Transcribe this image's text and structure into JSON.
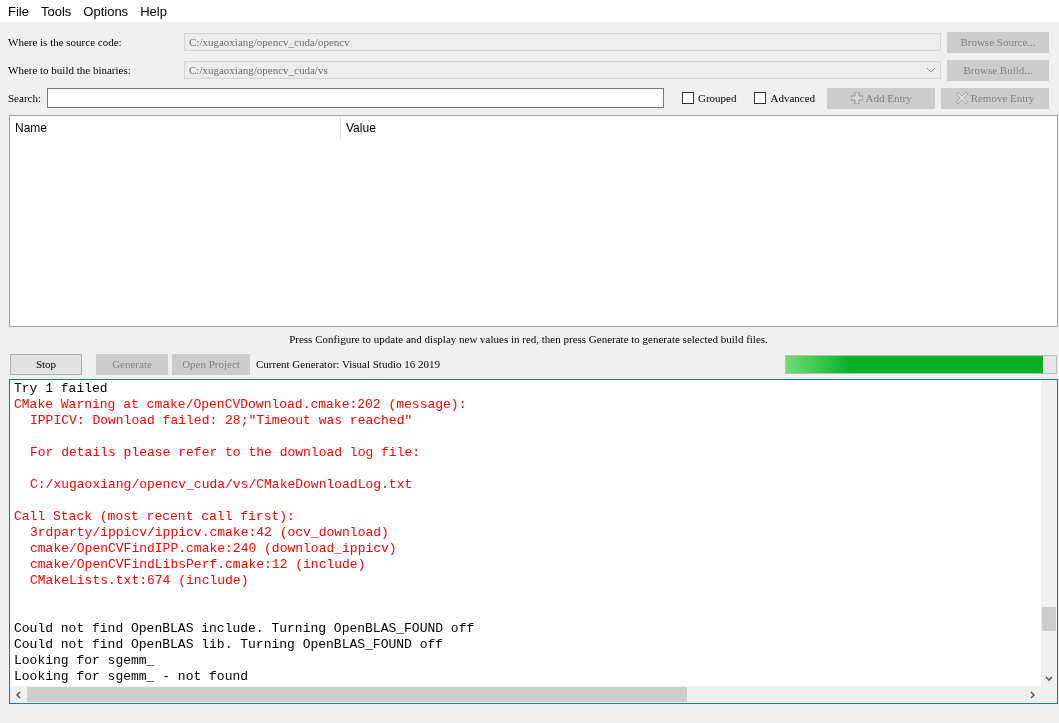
{
  "menu": [
    "File",
    "Tools",
    "Options",
    "Help"
  ],
  "source": {
    "label": "Where is the source code:",
    "value": "C:/xugaoxiang/opencv_cuda/opencv",
    "button": {
      "label": "Browse Source...",
      "disabled": true
    }
  },
  "build": {
    "label": "Where to build the binaries:",
    "value": "C:/xugaoxiang/opencv_cuda/vs",
    "button": {
      "label": "Browse Build...",
      "disabled": true
    }
  },
  "search": {
    "label": "Search:"
  },
  "options": [
    {
      "label": "Grouped",
      "checked": false
    },
    {
      "label": "Advanced",
      "checked": false
    }
  ],
  "entry_buttons": [
    {
      "kind": "add",
      "label": "Add Entry",
      "disabled": true
    },
    {
      "kind": "remove",
      "label": "Remove Entry",
      "disabled": true
    }
  ],
  "table": {
    "columns": [
      "Name",
      "Value"
    ]
  },
  "hint": "Press Configure to update and display new values in red, then press Generate to generate selected build files.",
  "actions": [
    {
      "label": "Stop",
      "disabled": false
    },
    {
      "label": "Generate",
      "disabled": true
    },
    {
      "label": "Open Project",
      "disabled": true
    }
  ],
  "generator": "Current Generator: Visual Studio 16 2019",
  "progress": {
    "level": 0.95
  },
  "log": [
    {
      "kind": "normal",
      "text": "Try 1 failed"
    },
    {
      "kind": "warning",
      "text": "CMake Warning at cmake/OpenCVDownload.cmake:202 (message):",
      "children": [
        {
          "kind": "warning",
          "text": "IPPICV: Download failed: 28;\"Timeout was reached\""
        },
        {
          "kind": "blank"
        },
        {
          "kind": "warning",
          "text": "For details please refer to the download log file:"
        },
        {
          "kind": "blank"
        },
        {
          "kind": "warning",
          "text": "C:/xugaoxiang/opencv_cuda/vs/CMakeDownloadLog.txt"
        }
      ]
    },
    {
      "kind": "blank"
    },
    {
      "kind": "warning",
      "text": "Call Stack (most recent call first):",
      "children": [
        {
          "kind": "warning",
          "text": "3rdparty/ippicv/ippicv.cmake:42 (ocv_download)"
        },
        {
          "kind": "warning",
          "text": "cmake/OpenCVFindIPP.cmake:240 (download_ippicv)"
        },
        {
          "kind": "warning",
          "text": "cmake/OpenCVFindLibsPerf.cmake:12 (include)"
        },
        {
          "kind": "warning",
          "text": "CMakeLists.txt:674 (include)"
        }
      ]
    },
    {
      "kind": "blank"
    },
    {
      "kind": "blank"
    },
    {
      "kind": "normal",
      "text": "Could not find OpenBLAS include. Turning OpenBLAS_FOUND off"
    },
    {
      "kind": "normal",
      "text": "Could not find OpenBLAS lib. Turning OpenBLAS_FOUND off"
    },
    {
      "kind": "normal",
      "text": "Looking for sgemm_"
    },
    {
      "kind": "normal",
      "text": "Looking for sgemm_ - not found"
    }
  ]
}
